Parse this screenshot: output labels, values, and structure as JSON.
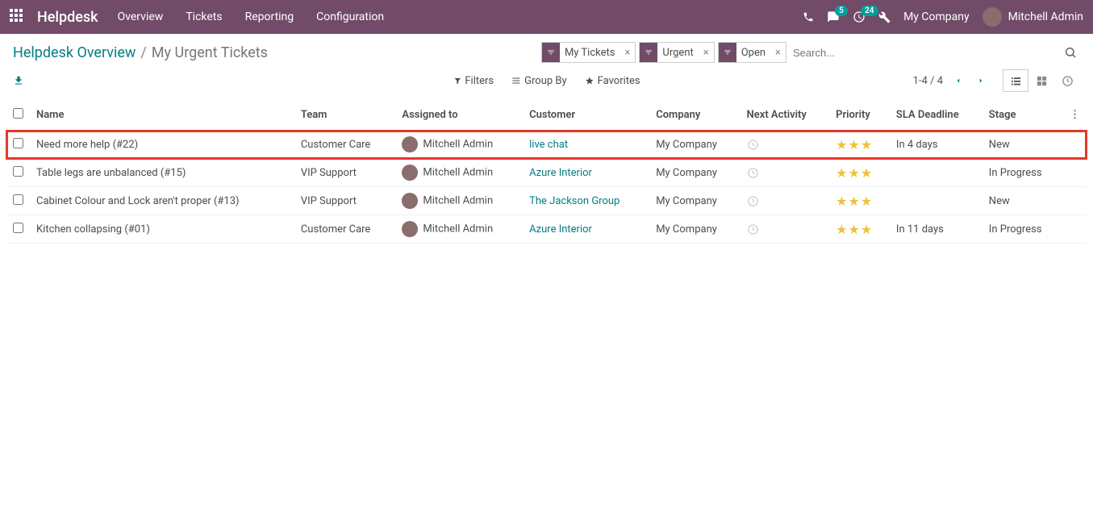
{
  "nav": {
    "brand": "Helpdesk",
    "items": [
      "Overview",
      "Tickets",
      "Reporting",
      "Configuration"
    ],
    "chat_badge": "5",
    "activity_badge": "24",
    "company": "My Company",
    "user": "Mitchell Admin"
  },
  "breadcrumb": {
    "root": "Helpdesk Overview",
    "sep": "/",
    "current": "My Urgent Tickets"
  },
  "search": {
    "facets": [
      "My Tickets",
      "Urgent",
      "Open"
    ],
    "placeholder": "Search..."
  },
  "filters": {
    "filters": "Filters",
    "groupby": "Group By",
    "favorites": "Favorites"
  },
  "pager": {
    "range": "1-4 / 4"
  },
  "columns": {
    "name": "Name",
    "team": "Team",
    "assigned": "Assigned to",
    "customer": "Customer",
    "company": "Company",
    "activity": "Next Activity",
    "priority": "Priority",
    "sla": "SLA Deadline",
    "stage": "Stage"
  },
  "rows": [
    {
      "name": "Need more help (#22)",
      "team": "Customer Care",
      "assigned": "Mitchell Admin",
      "customer": "live chat",
      "company": "My Company",
      "sla": "In 4 days",
      "stage": "New",
      "highlight": true
    },
    {
      "name": "Table legs are unbalanced (#15)",
      "team": "VIP Support",
      "assigned": "Mitchell Admin",
      "customer": "Azure Interior",
      "company": "My Company",
      "sla": "",
      "stage": "In Progress"
    },
    {
      "name": "Cabinet Colour and Lock aren't proper (#13)",
      "team": "VIP Support",
      "assigned": "Mitchell Admin",
      "customer": "The Jackson Group",
      "company": "My Company",
      "sla": "",
      "stage": "New"
    },
    {
      "name": "Kitchen collapsing (#01)",
      "team": "Customer Care",
      "assigned": "Mitchell Admin",
      "customer": "Azure Interior",
      "company": "My Company",
      "sla": "In 11 days",
      "stage": "In Progress"
    }
  ]
}
